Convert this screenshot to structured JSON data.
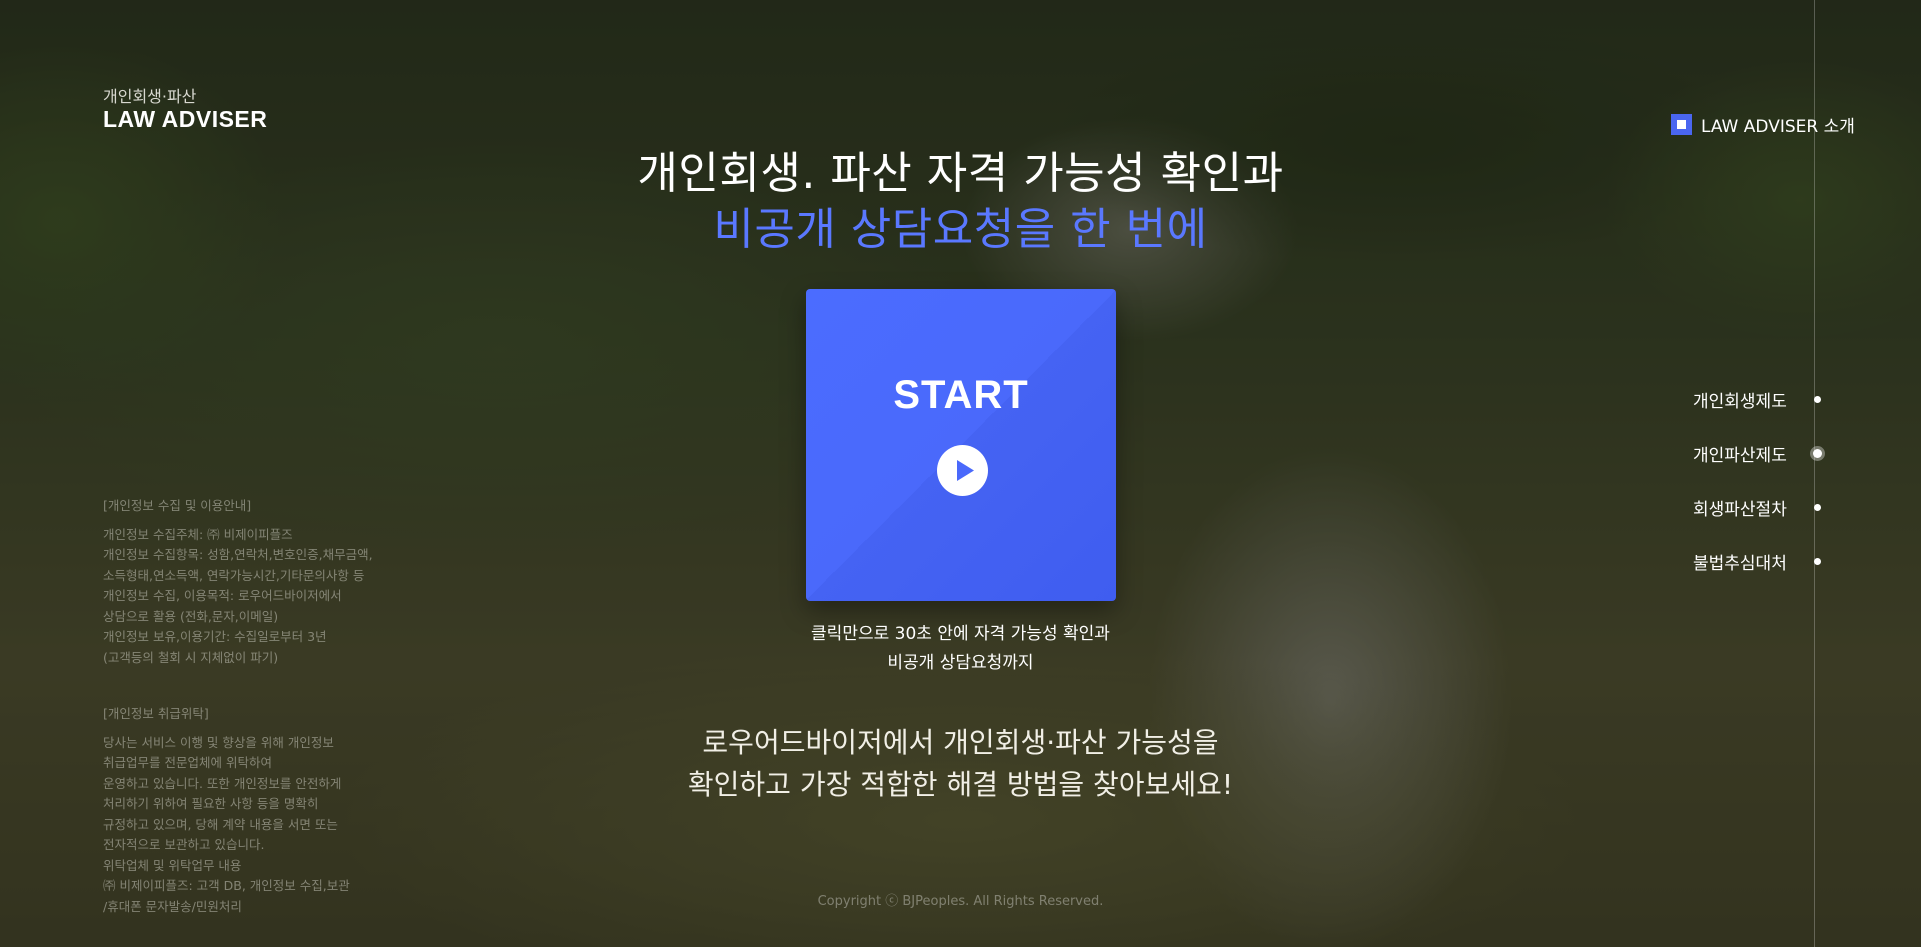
{
  "logo": {
    "sub": "개인회생·파산",
    "main": "LAW ADVISER"
  },
  "about": {
    "label": "LAW ADVISER 소개",
    "accent": "#4a66f0"
  },
  "headline": {
    "line1": "개인회생. 파산 자격 가능성 확인과",
    "line2": "비공개 상담요청을 한 번에",
    "accent": "#5a78ff"
  },
  "start_card": {
    "label": "START",
    "icon": "play-icon",
    "color": "#4a69fb"
  },
  "caption": {
    "line1": "클릭만으로 30초 안에 자격 가능성 확인과",
    "line2": "비공개 상담요청까지"
  },
  "description": {
    "line1": "로우어드바이저에서 개인회생·파산 가능성을",
    "line2": "확인하고 가장 적합한 해결 방법을 찾아보세요!"
  },
  "privacy_collection": {
    "title": "[개인정보 수집 및 이용안내]",
    "lines": [
      "개인정보 수집주체: ㈜ 비제이피플즈",
      "개인정보 수집항목: 성함,연락처,변호인증,채무금액,",
      "소득형태,연소득액, 연락가능시간,기타문의사항 등",
      "개인정보 수집, 이용목적: 로우어드바이저에서",
      "상담으로 활용 (전화,문자,이메일)",
      "개인정보 보유,이용기간: 수집일로부터 3년",
      "(고객등의 철회 시 지체없이 파기)"
    ]
  },
  "privacy_consign": {
    "title": "[개인정보 취급위탁]",
    "lines": [
      "당사는 서비스 이행 및 향상을 위해 개인정보",
      "취급업무를 전문업체에 위탁하여",
      "운영하고 있습니다. 또한 개인정보를 안전하게",
      "처리하기 위하여 필요한 사항 등을 명확히",
      "규정하고 있으며, 당해 계약 내용을 서면 또는",
      "전자적으로 보관하고 있습니다.",
      "위탁업체 및 위탁업무 내용",
      "㈜ 비제이피플즈: 고객 DB, 개인정보 수집,보관",
      "/휴대폰 문자발송/민원처리"
    ]
  },
  "right_nav": {
    "items": [
      {
        "label": "개인회생제도"
      },
      {
        "label": "개인파산제도"
      },
      {
        "label": "회생파산절차"
      },
      {
        "label": "불법추심대처"
      }
    ],
    "active_index": 1
  },
  "copyright": "Copyright ⓒ BJPeoples. All Rights Reserved."
}
